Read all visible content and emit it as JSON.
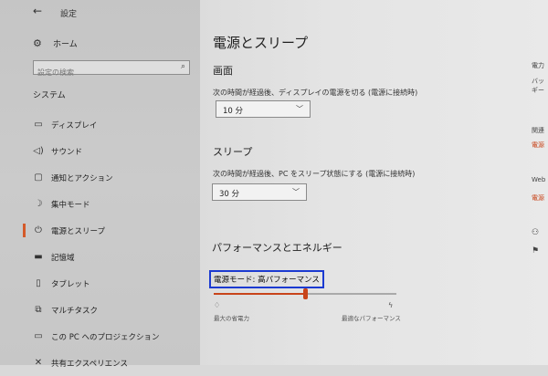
{
  "app": {
    "title": "設定"
  },
  "sidebar": {
    "home_label": "ホーム",
    "search_placeholder": "設定の検索",
    "section_label": "システム",
    "items": [
      {
        "label": "ディスプレイ",
        "icon": "display-icon"
      },
      {
        "label": "サウンド",
        "icon": "sound-icon"
      },
      {
        "label": "通知とアクション",
        "icon": "notification-icon"
      },
      {
        "label": "集中モード",
        "icon": "moon-icon"
      },
      {
        "label": "電源とスリープ",
        "icon": "power-icon",
        "active": true
      },
      {
        "label": "記憶域",
        "icon": "storage-icon"
      },
      {
        "label": "タブレット",
        "icon": "tablet-icon"
      },
      {
        "label": "マルチタスク",
        "icon": "multitask-icon"
      },
      {
        "label": "この PC へのプロジェクション",
        "icon": "projection-icon"
      },
      {
        "label": "共有エクスペリエンス",
        "icon": "share-icon"
      }
    ]
  },
  "main": {
    "title": "電源とスリープ",
    "screen": {
      "heading": "画面",
      "description": "次の時間が経過後、ディスプレイの電源を切る (電源に接続時)",
      "value": "10 分"
    },
    "sleep": {
      "heading": "スリープ",
      "description": "次の時間が経過後、PC をスリープ状態にする (電源に接続時)",
      "value": "30 分"
    },
    "performance": {
      "heading": "パフォーマンスとエネルギー",
      "mode_label": "電源モード: 高パフォーマンス",
      "left_label": "最大の省電力",
      "right_label": "最適なパフォーマンス",
      "slider_level": 0.5
    }
  },
  "related": {
    "label1": "電力",
    "label2": "バッ",
    "label3": "ギー",
    "label4": "関連",
    "link1": "電源",
    "label5": "Web",
    "link2": "電源"
  },
  "colors": {
    "accent": "#c8441a",
    "highlight_box": "#1b3ad1"
  }
}
